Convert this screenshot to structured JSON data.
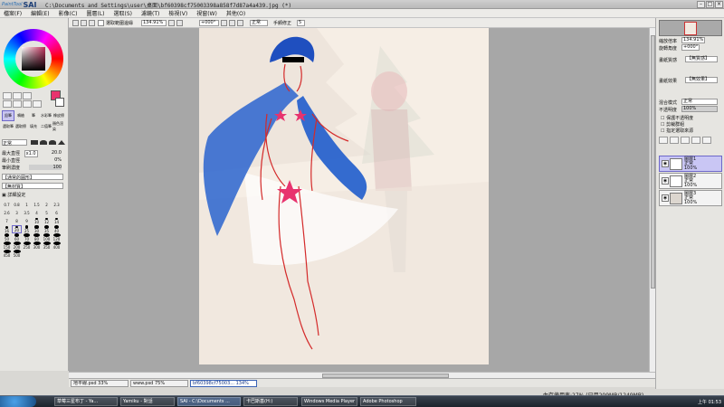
{
  "window": {
    "logo_prefix": "PaintTool",
    "logo_name": "SAI",
    "title": "C:\\Documents and Settings\\user\\桌面\\bf60398cf75003398a858f7d87a4a439.jpg (*)"
  },
  "menu": [
    "檔案(F)",
    "編輯(E)",
    "影像(C)",
    "圖層(L)",
    "選取(S)",
    "濾鏡(T)",
    "檢視(V)",
    "視窗(W)",
    "其他(O)"
  ],
  "toolbar": {
    "select_label": "選取範圍邊緣",
    "zoom": "134.91%",
    "angle": "+000°",
    "mode": "正常",
    "stabilizer_label": "手顫修正",
    "stabilizer_value": "5"
  },
  "left": {
    "tool_labels": [
      "鉛筆",
      "噴槍",
      "筆",
      "水彩筆",
      "橡皮擦",
      "選取筆",
      "選取擦",
      "填充",
      "二值筆",
      "顏色渲染"
    ],
    "blend_mode": "正常",
    "max_size_label": "最大直徑",
    "max_size_mult": "x1.0",
    "max_size_value": "20.0",
    "min_size_label": "最小直徑",
    "min_size_value": "0%",
    "density_label": "筆刷濃度",
    "density_value": "100",
    "shape_label": "【通常的圓形】",
    "texture_label": "【無材質】",
    "detail_label": "詳細設定",
    "brush_sizes": [
      "0.7",
      "0.8",
      "1",
      "1.5",
      "2",
      "2.3",
      "2.6",
      "3",
      "3.5",
      "4",
      "5",
      "6",
      "7",
      "8",
      "9",
      "10",
      "12",
      "14",
      "16",
      "20",
      "25",
      "30",
      "35",
      "40",
      "50",
      "60",
      "70",
      "80",
      "100",
      "120",
      "150",
      "200",
      "250",
      "300",
      "350",
      "400",
      "450",
      "500"
    ]
  },
  "right": {
    "zoom_label": "縮放倍率",
    "zoom_value": "134.91%",
    "rotate_label": "旋轉角度",
    "rotate_value": "+000°",
    "paper_texture_label": "畫紙質感",
    "paper_texture_value": "【無質感】",
    "paper_effect_label": "畫紙效果",
    "paper_effect_value": "【無效果】",
    "blend_label": "混合模式",
    "blend_value": "正常",
    "opacity_label": "不透明度",
    "opacity_value": "100%",
    "options": [
      "保護不透明度",
      "剪裁群組",
      "指定選取來源"
    ],
    "layers": [
      {
        "name": "圖層1",
        "mode": "正常",
        "opacity": "100%"
      },
      {
        "name": "圖層2",
        "mode": "正常",
        "opacity": "100%"
      },
      {
        "name": "圖層3",
        "mode": "正常",
        "opacity": "100%"
      }
    ]
  },
  "documents": [
    {
      "name": "地平線.psd",
      "zoom": "33%"
    },
    {
      "name": "www.psd",
      "zoom": "75%"
    },
    {
      "name": "bf60398cf75003...",
      "zoom": "134%"
    }
  ],
  "status": "內存使用率:27% (已用209MB/1249MB)",
  "taskbar": {
    "items": [
      "草莓三星布丁 - Ya...",
      "Yamiku - 對話",
      "SAI - C:\\Documents ...",
      "卡巴斯基(H:)",
      "Windows Media Player",
      "Adobe Photoshop"
    ],
    "clock": "上午 01:53"
  },
  "colors": {
    "primary": "#e8336e",
    "secondary": "#ffffff",
    "layer_selected": "#c9c6f4",
    "ink_blue": "#1f5ccc",
    "ink_red": "#d42a2a"
  }
}
